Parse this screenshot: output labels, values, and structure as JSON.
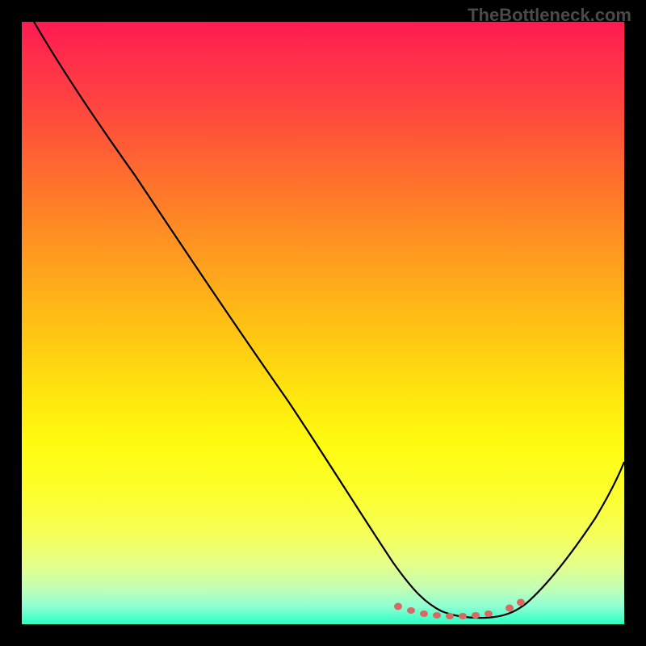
{
  "watermark": "TheBottleneck.com",
  "chart_data": {
    "type": "line",
    "title": "",
    "xlabel": "",
    "ylabel": "",
    "xlim": [
      0,
      100
    ],
    "ylim": [
      0,
      100
    ],
    "grid": false,
    "legend": false,
    "description": "Bottleneck curve over gradient background (red=high bottleneck at top, green=low at bottom). Curve descends steeply from upper-left, flattens near bottom around x≈70, then rises toward right edge.",
    "series": [
      {
        "name": "bottleneck-curve",
        "x": [
          2,
          10,
          20,
          30,
          40,
          50,
          58,
          62,
          66,
          70,
          74,
          78,
          82,
          86,
          90,
          94,
          100
        ],
        "y": [
          100,
          88,
          74,
          60,
          46,
          32,
          20,
          14,
          8,
          4,
          2,
          1,
          2,
          4,
          8,
          14,
          29
        ]
      }
    ],
    "markers": {
      "name": "highlight-dots",
      "color": "#d96a63",
      "points_x": [
        62,
        64,
        66,
        68,
        70,
        72,
        74,
        76,
        80,
        82
      ],
      "points_y": [
        4.5,
        3.8,
        3.2,
        2.8,
        2.5,
        2.4,
        2.5,
        2.8,
        4.0,
        5.0
      ]
    },
    "gradient_stops": [
      {
        "pos": 0,
        "color": "#ff1a52"
      },
      {
        "pos": 50,
        "color": "#ffcd12"
      },
      {
        "pos": 100,
        "color": "#2cffc2"
      }
    ]
  }
}
